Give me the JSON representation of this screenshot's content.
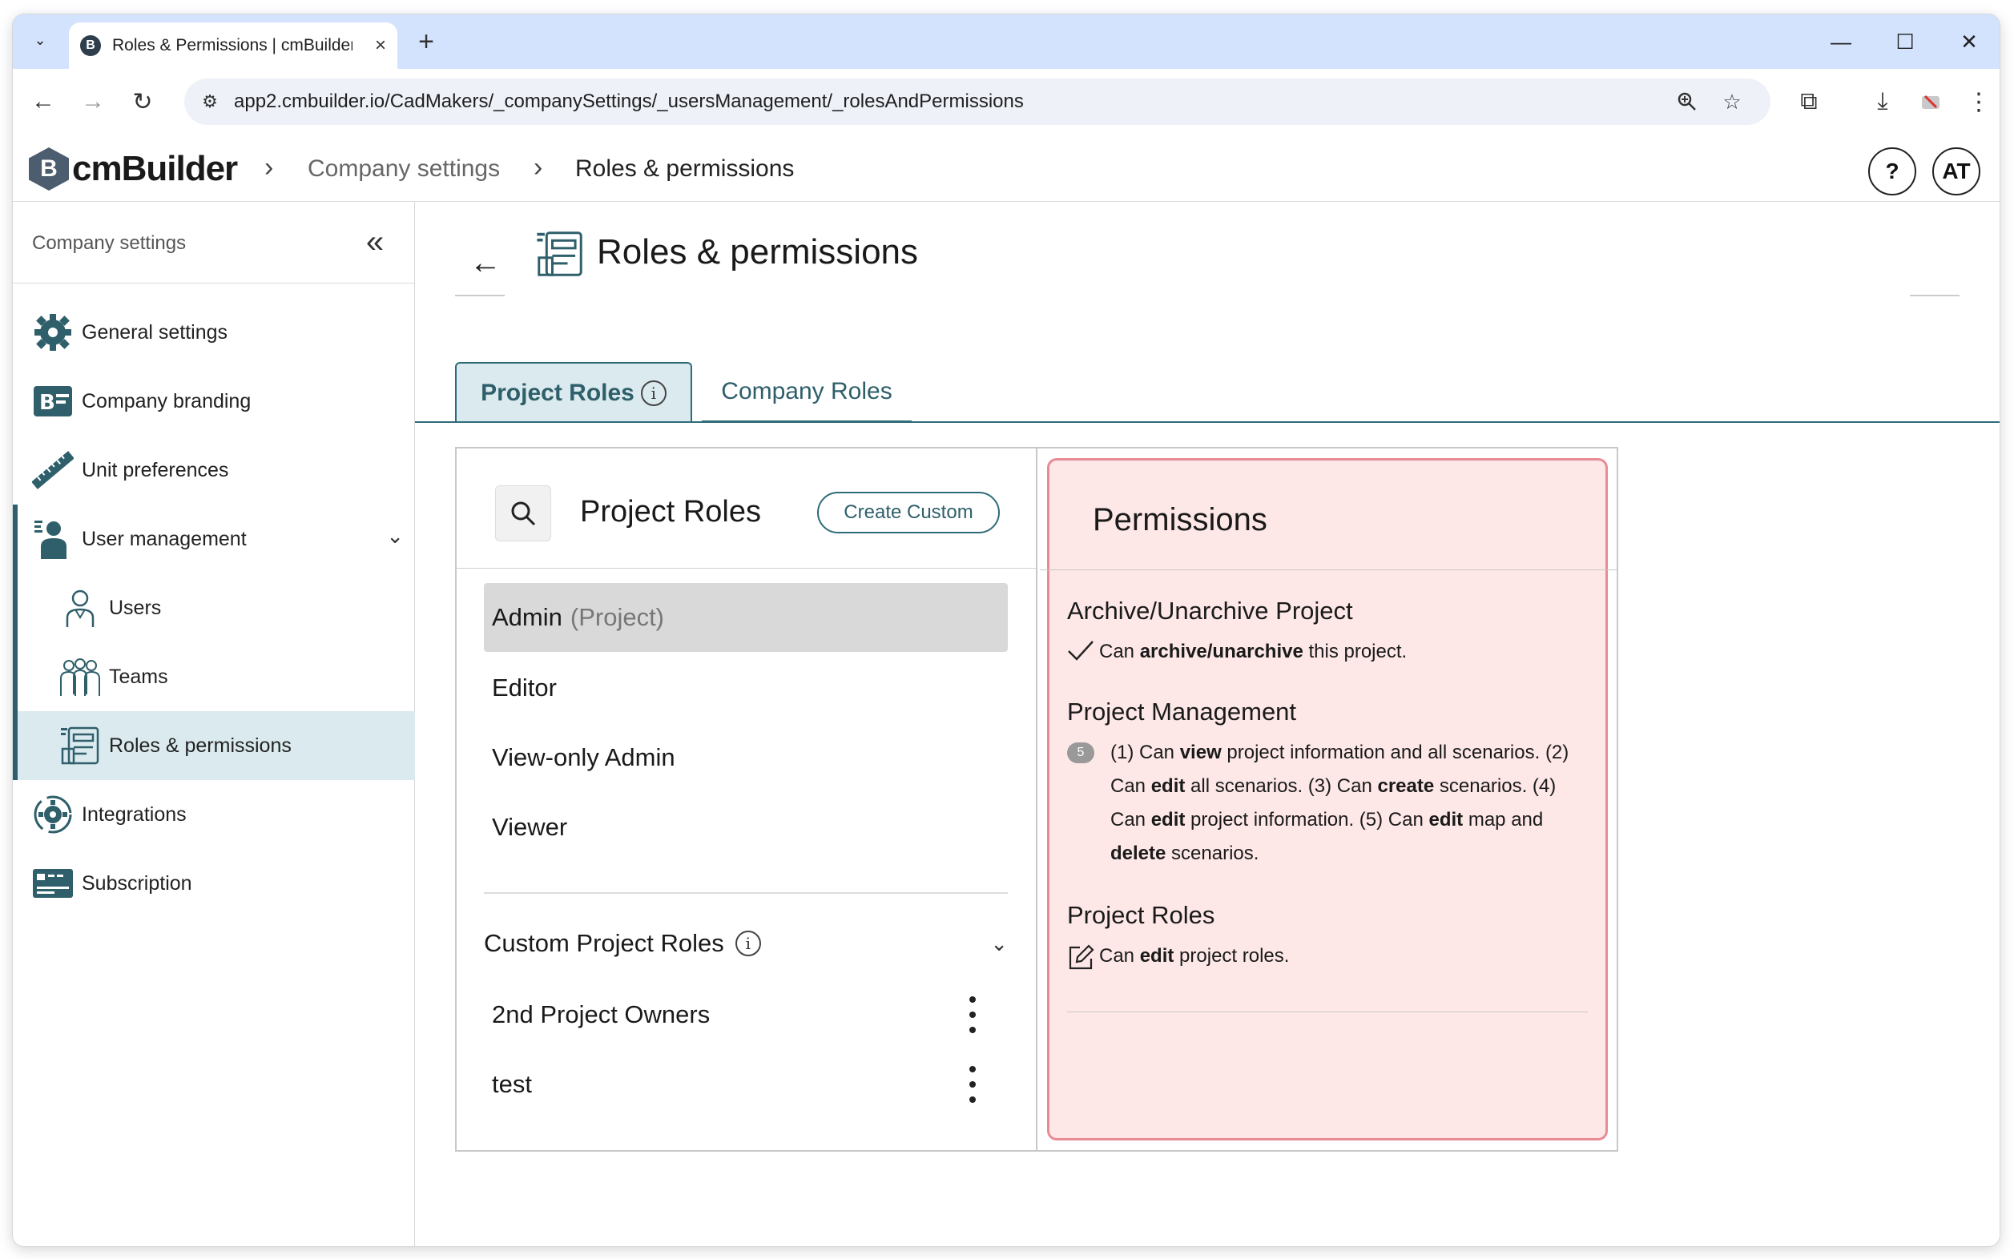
{
  "browser": {
    "tab_title": "Roles & Permissions | cmBuilder",
    "tab_favicon": "B",
    "url": "app2.cmbuilder.io/CadMakers/_companySettings/_usersManagement/_rolesAndPermissions"
  },
  "header": {
    "logo_text": "cmBuilder",
    "logo_mark": "B",
    "breadcrumb": [
      "Company settings",
      "Roles & permissions"
    ],
    "help_label": "?",
    "avatar_initials": "AT"
  },
  "sidebar": {
    "title": "Company settings",
    "items": [
      {
        "label": "General settings",
        "icon": "gear-icon"
      },
      {
        "label": "Company branding",
        "icon": "branding-icon"
      },
      {
        "label": "Unit preferences",
        "icon": "ruler-icon"
      },
      {
        "label": "User management",
        "icon": "user-management-icon"
      },
      {
        "label": "Users",
        "icon": "user-icon"
      },
      {
        "label": "Teams",
        "icon": "teams-icon"
      },
      {
        "label": "Roles & permissions",
        "icon": "roles-icon"
      },
      {
        "label": "Integrations",
        "icon": "integrations-icon"
      },
      {
        "label": "Subscription",
        "icon": "subscription-icon"
      }
    ]
  },
  "main": {
    "title": "Roles & permissions",
    "tabs": [
      {
        "label": "Project Roles",
        "active": true
      },
      {
        "label": "Company Roles",
        "active": false
      }
    ],
    "roles_panel": {
      "title": "Project Roles",
      "create_label": "Create Custom",
      "roles": [
        {
          "name": "Admin",
          "suffix": "(Project)",
          "selected": true
        },
        {
          "name": "Editor"
        },
        {
          "name": "View-only Admin"
        },
        {
          "name": "Viewer"
        }
      ],
      "custom_title": "Custom Project Roles",
      "custom_roles": [
        {
          "name": "2nd Project Owners"
        },
        {
          "name": "test"
        }
      ]
    },
    "permissions": {
      "title": "Permissions",
      "groups": [
        {
          "title": "Archive/Unarchive Project",
          "icon": "check-icon",
          "parts": [
            "Can ",
            "archive/unarchive",
            " this project."
          ]
        },
        {
          "title": "Project Management",
          "badge": "5",
          "parts": [
            "(1) Can ",
            "view",
            " project information and all scenarios. (2) Can ",
            "edit",
            " all scenarios. (3) Can ",
            "create",
            " scenarios. (4) Can ",
            "edit",
            " project information. (5) Can ",
            "edit",
            " map and ",
            "delete",
            " scenarios."
          ]
        },
        {
          "title": "Project Roles",
          "icon": "edit-icon",
          "parts": [
            "Can ",
            "edit",
            " project roles."
          ]
        }
      ]
    }
  },
  "colors": {
    "accent": "#2e6b78",
    "active_bg": "#daeaee",
    "permissions_bg": "#fde7e7",
    "permissions_border": "#e88b95",
    "browser_tabbar": "#d3e3fd"
  }
}
